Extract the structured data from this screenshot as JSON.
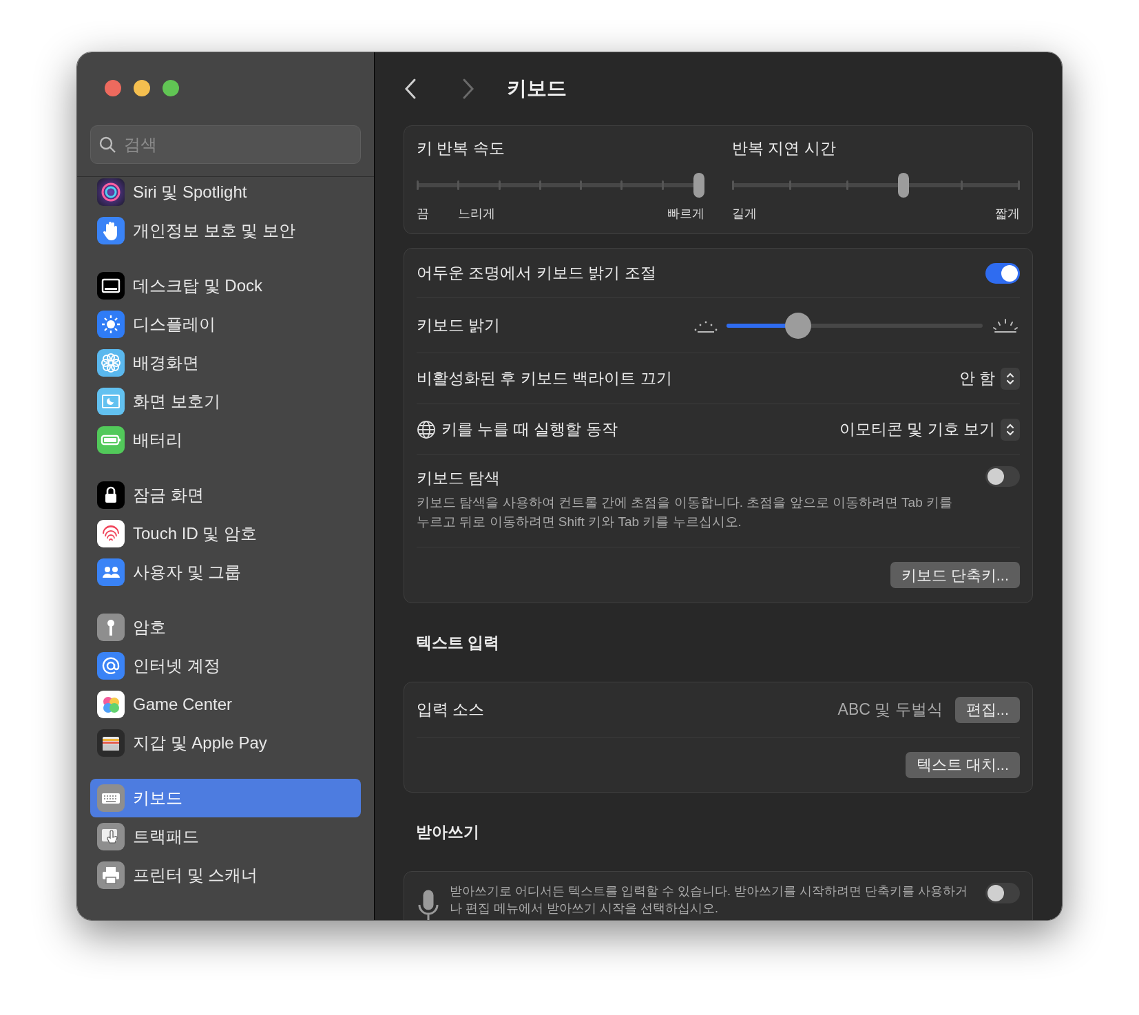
{
  "window": {
    "title": "키보드"
  },
  "sidebar": {
    "search": {
      "placeholder": "검색"
    },
    "groups": [
      {
        "items": [
          {
            "label": "Siri 및 Spotlight",
            "selected": false
          },
          {
            "label": "개인정보 보호 및 보안",
            "selected": false
          }
        ]
      },
      {
        "items": [
          {
            "label": "데스크탑 및 Dock",
            "selected": false
          },
          {
            "label": "디스플레이",
            "selected": false
          },
          {
            "label": "배경화면",
            "selected": false
          },
          {
            "label": "화면 보호기",
            "selected": false
          },
          {
            "label": "배터리",
            "selected": false
          }
        ]
      },
      {
        "items": [
          {
            "label": "잠금 화면",
            "selected": false
          },
          {
            "label": "Touch ID 및 암호",
            "selected": false
          },
          {
            "label": "사용자 및 그룹",
            "selected": false
          }
        ]
      },
      {
        "items": [
          {
            "label": "암호",
            "selected": false
          },
          {
            "label": "인터넷 계정",
            "selected": false
          },
          {
            "label": "Game Center",
            "selected": false
          },
          {
            "label": "지갑 및 Apple Pay",
            "selected": false
          }
        ]
      },
      {
        "items": [
          {
            "label": "키보드",
            "selected": true
          },
          {
            "label": "트랙패드",
            "selected": false
          },
          {
            "label": "프린터 및 스캐너",
            "selected": false
          }
        ]
      }
    ]
  },
  "key_repeat": {
    "sliders": [
      {
        "title": "키 반복 속도",
        "level": 1,
        "labels": [
          "끔",
          "느리게",
          "빠르게"
        ]
      },
      {
        "title": "반복 지연 시간",
        "level": 0.6,
        "labels": [
          "길게",
          "짧게"
        ]
      }
    ]
  },
  "keyboard_settings": {
    "rows": [
      {
        "kind": "toggle",
        "label": "어두운 조명에서 키보드 밝기 조절",
        "on": true
      },
      {
        "kind": "slider",
        "label": "키보드 밝기",
        "level": 0.28
      },
      {
        "kind": "popup",
        "label": "비활성화된 후 키보드 백라이트 끄기",
        "value": "안 함"
      },
      {
        "kind": "globe",
        "label": "키를 누를 때 실행할 동작",
        "value": "이모티콘 및 기호 보기"
      },
      {
        "kind": "toggle",
        "label": "키보드 탐색",
        "on": false,
        "description": "키보드 탐색을 사용하여 컨트롤 간에 초점을 이동합니다. 초점을 앞으로 이동하려면 Tab 키를 누르고 뒤로 이동하려면 Shift 키와 Tab 키를 누르십시오."
      },
      {
        "kind": "button",
        "button": "키보드 단축키..."
      }
    ]
  },
  "text_input": {
    "heading": "텍스트 입력",
    "rows": [
      {
        "kind": "value",
        "label": "입력 소스",
        "value": "ABC 및 두벌식",
        "button": "편집..."
      },
      {
        "kind": "button",
        "button": "텍스트 대치..."
      }
    ]
  },
  "dictation": {
    "heading": "받아쓰기",
    "description": "받아쓰기로 어디서든 텍스트를 입력할 수 있습니다. 받아쓰기를 시작하려면 단축키를 사용하거나 편집 메뉴에서 받아쓰기 시작을 선택하십시오.",
    "on": false
  }
}
